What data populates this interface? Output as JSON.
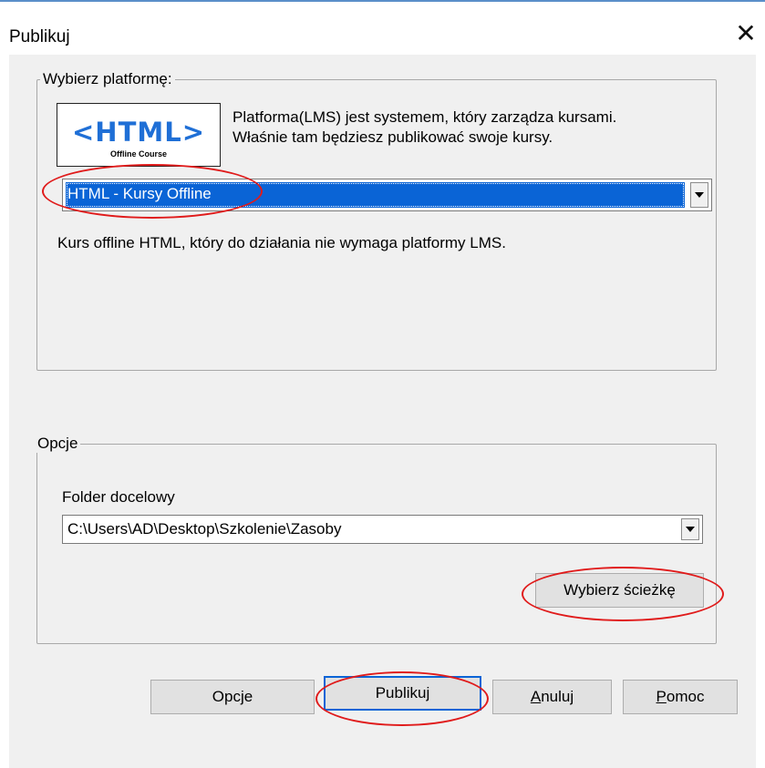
{
  "window": {
    "title": "Publikuj"
  },
  "platform_group": {
    "legend": "Wybierz platformę:",
    "logo": {
      "main": "<HTML>",
      "sub": "Offline Course"
    },
    "info_line1": "Platforma(LMS) jest systemem, który zarządza kursami.",
    "info_line2": "Właśnie tam będziesz publikować swoje kursy.",
    "selected": "HTML - Kursy Offline",
    "description": "Kurs offline HTML, który do działania nie wymaga platformy LMS."
  },
  "options_group": {
    "legend": "Opcje",
    "folder_label": "Folder docelowy",
    "folder_value": "C:\\Users\\AD\\Desktop\\Szkolenie\\Zasoby",
    "browse_button": "Wybierz ścieżkę"
  },
  "buttons": {
    "options": "Opcje",
    "publish": "Publikuj",
    "cancel": {
      "u": "A",
      "rest": "nuluj"
    },
    "help": {
      "u": "P",
      "rest": "omoc"
    }
  },
  "colors": {
    "accent": "#0a64d6",
    "annotation": "#e01b1b",
    "top_border": "#5a8fc9"
  },
  "icons": [
    "close-icon",
    "chevron-down-icon"
  ]
}
